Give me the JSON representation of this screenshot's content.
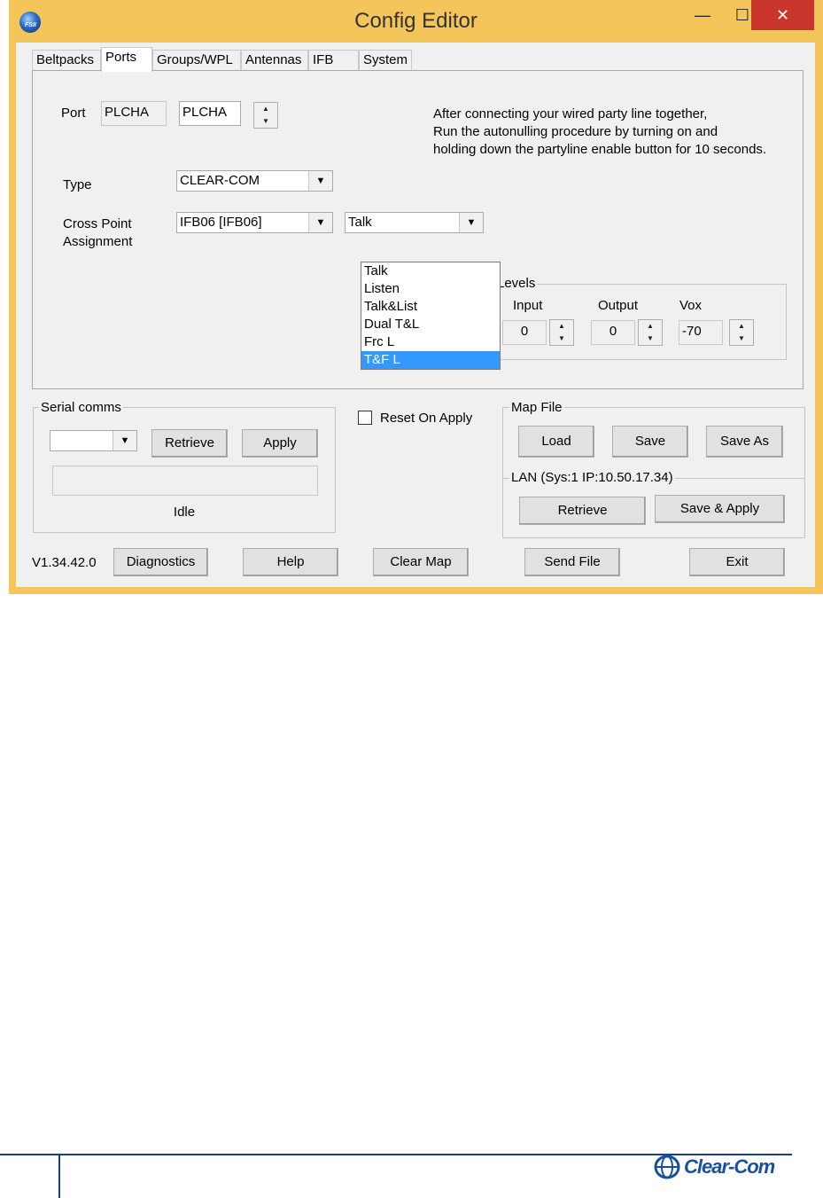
{
  "window": {
    "title": "Config Editor",
    "app_icon": "fsii-globe-icon",
    "min_glyph": "—",
    "max_glyph": "☐",
    "close_glyph": "✕"
  },
  "tabs": [
    "Beltpacks",
    "Ports",
    "Groups/WPL",
    "Antennas",
    "IFB",
    "System"
  ],
  "active_tab": "Ports",
  "port": {
    "label": "Port",
    "readonly_value": "PLCHA",
    "edit_value": "PLCHA"
  },
  "instructions": [
    "After connecting your wired party line together,",
    "Run the autonulling procedure by turning on and",
    "holding down the partyline enable button for 10 seconds."
  ],
  "type": {
    "label": "Type",
    "value": "CLEAR-COM"
  },
  "cross_point": {
    "label_line1": "Cross Point",
    "label_line2": "Assignment",
    "assignment_value": "IFB06  [IFB06]",
    "mode_value": "Talk",
    "mode_options": [
      "Talk",
      "Listen",
      "Talk&List",
      "Dual T&L",
      "Frc L",
      "T&F L"
    ],
    "highlighted_option": "T&F L"
  },
  "levels": {
    "title": "Levels",
    "input_label": "Input",
    "input_value": "0",
    "output_label": "Output",
    "output_value": "0",
    "vox_label": "Vox",
    "vox_value": "-70"
  },
  "serial_comms": {
    "title": "Serial comms",
    "port_value": "",
    "retrieve_label": "Retrieve",
    "apply_label": "Apply",
    "status_text": "Idle"
  },
  "reset_on_apply": {
    "label": "Reset On Apply",
    "checked": false
  },
  "map_file": {
    "title": "Map File",
    "load_label": "Load",
    "save_label": "Save",
    "save_as_label": "Save As"
  },
  "lan": {
    "title": "LAN  (Sys:1 IP:10.50.17.34)",
    "retrieve_label": "Retrieve",
    "save_apply_label": "Save & Apply"
  },
  "bottom_bar": {
    "version": "V1.34.42.0",
    "diagnostics_label": "Diagnostics",
    "help_label": "Help",
    "clear_map_label": "Clear Map",
    "send_file_label": "Send File",
    "exit_label": "Exit"
  },
  "footer": {
    "logo_text": "Clear-Com",
    "brand_color": "#1a4fa0"
  },
  "colors": {
    "window_frame": "#f4c55a",
    "close_button": "#c9352a",
    "selection": "#3399ff"
  }
}
